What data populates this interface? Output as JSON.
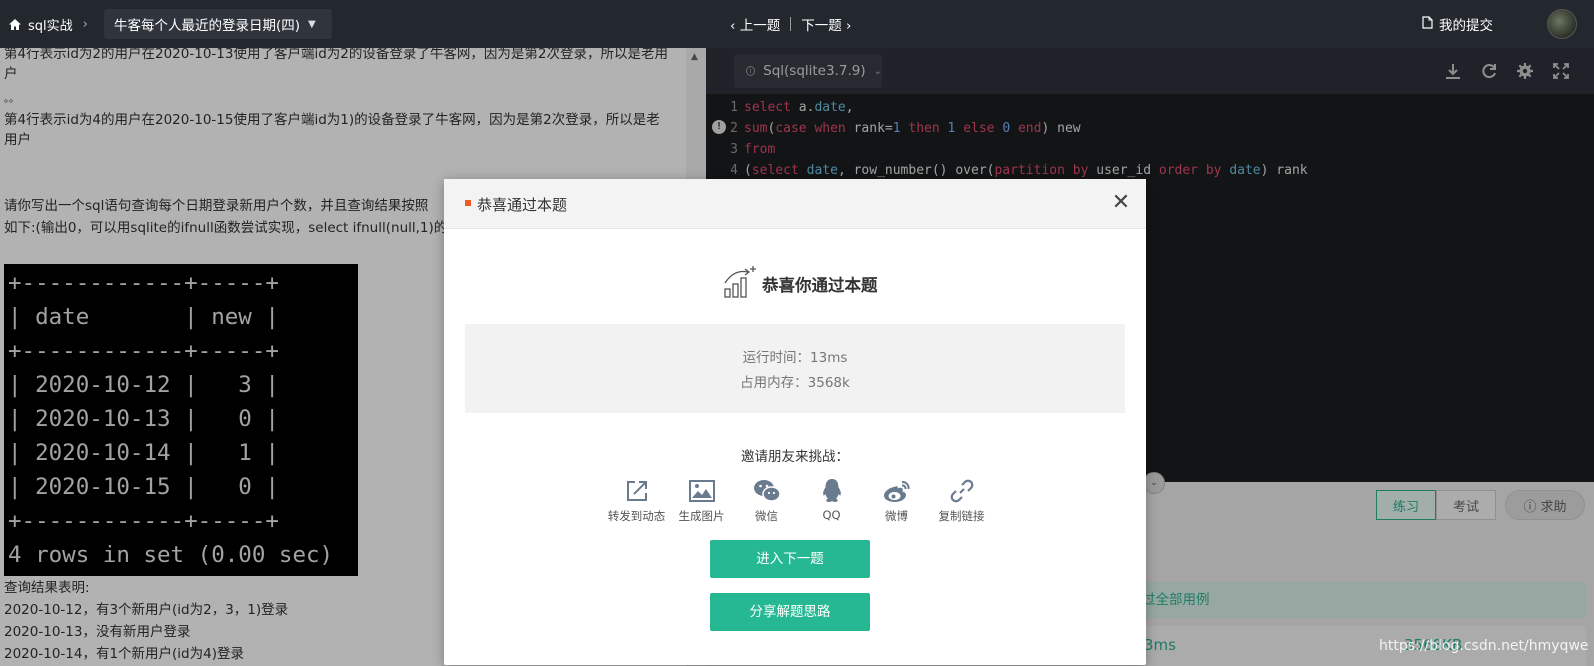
{
  "topbar": {
    "home_label": "sql实战",
    "problem_title": "牛客每个人最近的登录日期(四)",
    "prev_label": "上一题",
    "next_label": "下一题",
    "submissions_label": "我的提交"
  },
  "problem": {
    "line1": "第4行表示id为2的用户在2020-10-13使用了客户端id为2的设备登录了牛客网，因为是第2次登录，所以是老用",
    "line1b": "户",
    "dots": "。。",
    "line2": "第4行表示id为4的用户在2020-10-15使用了客户端id为1)的设备登录了牛客网，因为是第2次登录，所以是老",
    "line2b": "用户",
    "ask1": "请你写出一个sql语句查询每个日期登录新用户个数，并且查询结果按照",
    "ask2": "如下:(输出0，可以用sqlite的ifnull函数尝试实现，select ifnull(null,1)的输",
    "terminal": "+------------+-----+\n| date       | new |\n+------------+-----+\n| 2020-10-12 |   3 |\n| 2020-10-13 |   0 |\n| 2020-10-14 |   1 |\n| 2020-10-15 |   0 |\n+------------+-----+\n4 rows in set (0.00 sec)",
    "explain_title": "查询结果表明:",
    "explain1": "2020-10-12，有3个新用户(id为2，3，1)登录",
    "explain2": "2020-10-13，没有新用户登录",
    "explain3": "2020-10-14，有1个新用户(id为4)登录"
  },
  "editor": {
    "language": "Sql(sqlite3.7.9)",
    "tools": [
      "download-icon",
      "refresh-icon",
      "settings-icon",
      "fullscreen-icon"
    ]
  },
  "bottom": {
    "tab_practice": "练习",
    "tab_exam": "考试",
    "help_label": "求助",
    "pass_text": "过全部用例",
    "time_value": "3ms",
    "mem_value": "3568KB"
  },
  "modal": {
    "title": "恭喜通过本题",
    "congrats": "恭喜你通过本题",
    "runtime": "运行时间：13ms",
    "memory": "占用内存：3568k",
    "invite": "邀请朋友来挑战：",
    "share": [
      {
        "label": "转发到动态",
        "icon": "forward-icon"
      },
      {
        "label": "生成图片",
        "icon": "image-icon"
      },
      {
        "label": "微信",
        "icon": "wechat-icon"
      },
      {
        "label": "QQ",
        "icon": "qq-icon"
      },
      {
        "label": "微博",
        "icon": "weibo-icon"
      },
      {
        "label": "复制链接",
        "icon": "link-icon"
      }
    ],
    "next_button": "进入下一题",
    "share_button": "分享解题思路"
  },
  "watermark": "https://blog.csdn.net/hmyqwe",
  "colors": {
    "accent": "#26b893",
    "topbar": "#23272e",
    "mark": "#f15a24"
  }
}
